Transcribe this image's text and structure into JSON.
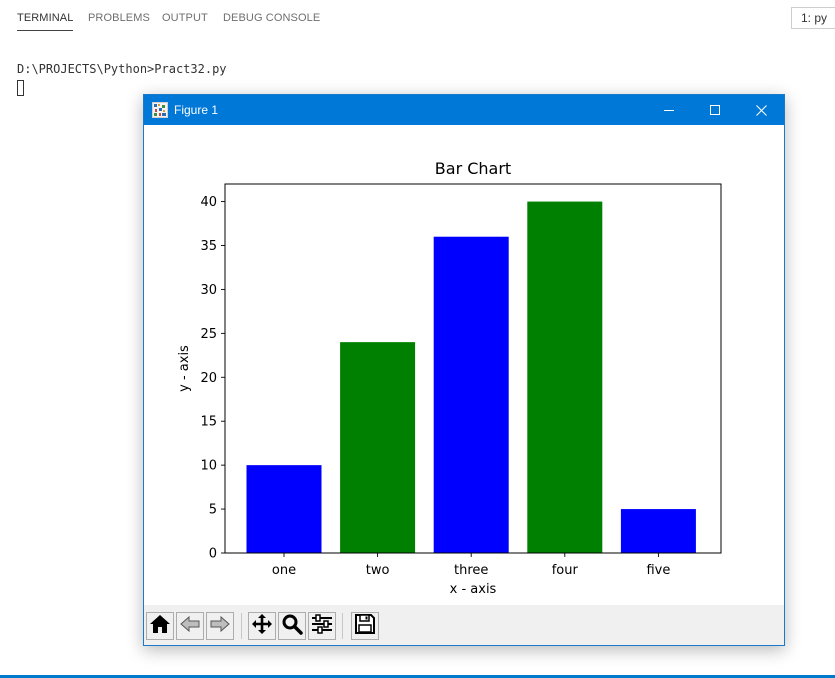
{
  "panel": {
    "tabs": [
      {
        "label": "TERMINAL",
        "active": true
      },
      {
        "label": "PROBLEMS",
        "active": false
      },
      {
        "label": "OUTPUT",
        "active": false
      },
      {
        "label": "DEBUG CONSOLE",
        "active": false
      }
    ],
    "terminal_selector": "1: py"
  },
  "terminal": {
    "command_line": "D:\\PROJECTS\\Python>Pract32.py"
  },
  "figure_window": {
    "title": "Figure 1",
    "title_bar_color": "#0078d7",
    "icons": {
      "app": "matplotlib-figure-icon",
      "minimize": "minimize-icon",
      "maximize": "maximize-icon",
      "close": "close-icon"
    },
    "toolbar_icons": [
      "home-icon",
      "back-arrow-icon",
      "forward-arrow-icon",
      "pan-move-icon",
      "zoom-magnifier-icon",
      "configure-subplots-icon",
      "save-floppy-icon"
    ]
  },
  "chart_data": {
    "type": "bar",
    "title": "Bar Chart",
    "xlabel": "x - axis",
    "ylabel": "y - axis",
    "categories": [
      "one",
      "two",
      "three",
      "four",
      "five"
    ],
    "values": [
      10,
      24,
      36,
      40,
      5
    ],
    "colors": [
      "#0000ff",
      "#008000",
      "#0000ff",
      "#008000",
      "#0000ff"
    ],
    "ylim": [
      0,
      42
    ],
    "yticks": [
      0,
      5,
      10,
      15,
      20,
      25,
      30,
      35,
      40
    ],
    "grid": false
  }
}
